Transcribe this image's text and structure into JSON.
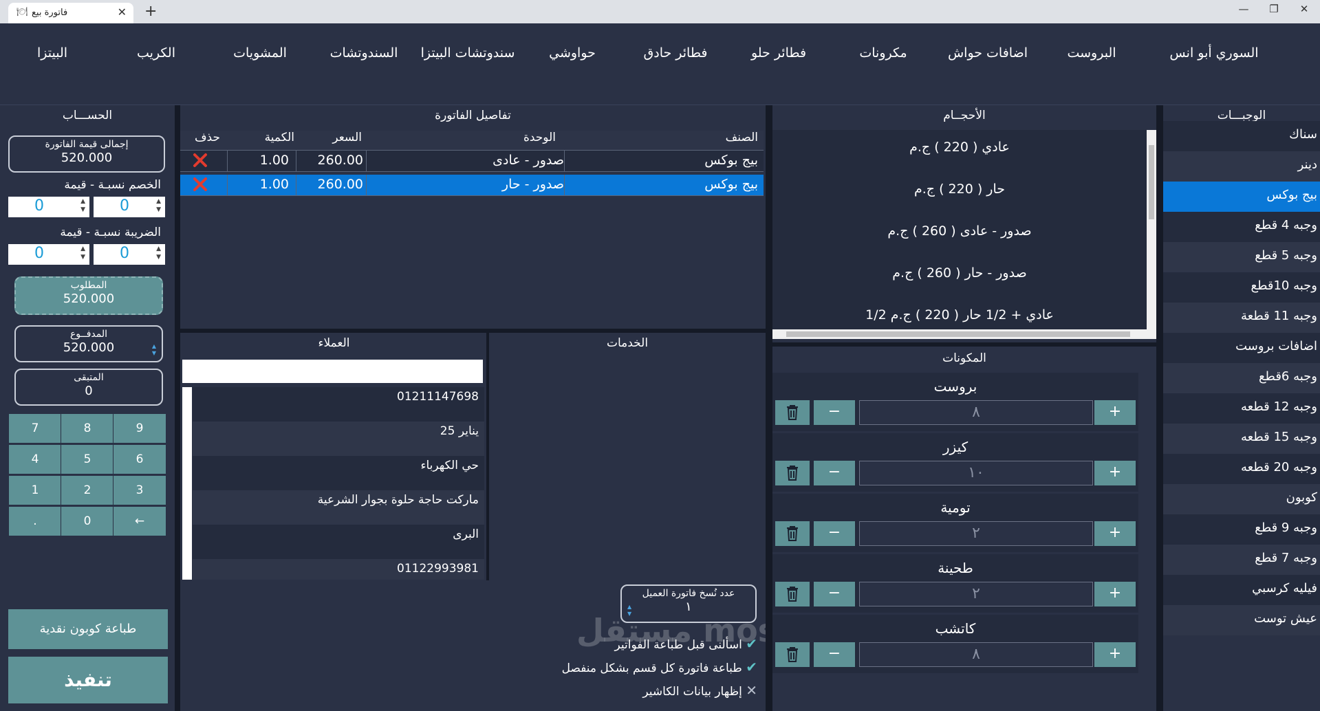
{
  "window": {
    "tab_title": "فاتورة بيع",
    "new_tab": "+",
    "close_tab": "✕",
    "minimize": "—",
    "maximize": "❐",
    "close": "✕"
  },
  "categories": [
    "السوري أبو انس",
    "البروست",
    "اضافات حواش",
    "مكرونات",
    "فطائر حلو",
    "فطائر حادق",
    "حواوشي",
    "سندوتشات البيتزا",
    "السندوتشات",
    "المشويات",
    "الكريب",
    "البيتزا"
  ],
  "account": {
    "title": "الحســـاب",
    "invoice_total_label": "إجمالى قيمة الفاتورة",
    "invoice_total_value": "520.000",
    "discount_label": "الخصم نسبـة - قيمة",
    "discount_percent": "0",
    "discount_value": "0",
    "tax_label": "الضريبة نسبـة - قيمة",
    "tax_percent": "0",
    "tax_value": "0",
    "required_label": "المطلوب",
    "required_value": "520.000",
    "paid_label": "المدفــوع",
    "paid_value": "520.000",
    "remaining_label": "المتبقى",
    "remaining_value": "0",
    "keypad": [
      "7",
      "8",
      "9",
      "4",
      "5",
      "6",
      "1",
      "2",
      "3",
      ".",
      "0",
      "←"
    ],
    "print_coupon": "طباعة كوبون نقدية",
    "execute": "تنفيذ"
  },
  "invoice": {
    "title": "تفاصيل الفاتورة",
    "headers": {
      "item": "الصنف",
      "unit": "الوحدة",
      "price": "السعر",
      "qty": "الكمية",
      "delete": "حذف"
    },
    "rows": [
      {
        "item": "بيج بوكس",
        "unit": "صدور - عادى",
        "price": "260.00",
        "qty": "1.00",
        "selected": false
      },
      {
        "item": "بيج بوكس",
        "unit": "صدور - حار",
        "price": "260.00",
        "qty": "1.00",
        "selected": true
      }
    ]
  },
  "customers": {
    "title": "العملاء",
    "search_value": "",
    "list": [
      "01211147698",
      "يناير 25",
      "حي الكهرباء",
      "ماركت حاجة حلوة بجوار الشرعية",
      "البرى",
      "01122993981"
    ]
  },
  "services": {
    "title": "الخدمات"
  },
  "options": {
    "copies_label": "عدد نُسخ فاتورة العميل",
    "copies_value": "١",
    "ask_before_print": "اسألنى قبل طباعة الفواتير",
    "print_each_section": "طباعة فاتورة كل قسم بشكل منفصل",
    "show_cashier": "إظهار بيانات الكاشير",
    "watermark": "مستقل mostaql.com"
  },
  "sizes": {
    "title": "الأحجــام",
    "list": [
      "عادي ( 220 ) ج.م",
      "حار ( 220 ) ج.م",
      "صدور - عادى ( 260 ) ج.م",
      "صدور - حار ( 260 ) ج.م",
      "1/2 عادي + 1/2 حار ( 220 ) ج.م"
    ]
  },
  "ingredients": {
    "title": "المكونات",
    "list": [
      {
        "name": "بروست",
        "qty": "٨"
      },
      {
        "name": "كيزر",
        "qty": "١٠"
      },
      {
        "name": "تومية",
        "qty": "٢"
      },
      {
        "name": "طحينة",
        "qty": "٢"
      },
      {
        "name": "كاتشب",
        "qty": "٨"
      }
    ]
  },
  "meals": {
    "title": "الوجبـــات",
    "list": [
      "سناك",
      "دينر",
      "بيج بوكس",
      "وجبه 4 قطع",
      "وجبه 5 قطع",
      "وجبه 10قطع",
      "وجبه 11 قطعة",
      "اضافات بروست",
      "وجبه 6قطع",
      "وجبه 12 قطعه",
      "وجبه 15 قطعه",
      "وجبه 20 قطعه",
      "كوبون",
      "وجبه 9 قطع",
      "وجبه 7 قطع",
      "فيليه كرسبي",
      "عيش توست"
    ],
    "selected_index": 2
  },
  "colors": {
    "accent": "#0a78d7",
    "button": "#5e9296",
    "panel": "#2a3145",
    "background": "#242b3d"
  }
}
